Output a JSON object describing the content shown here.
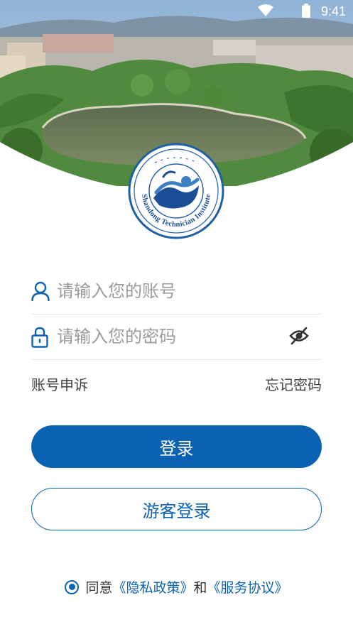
{
  "status_bar": {
    "time": "9:41"
  },
  "logo": {
    "caption": "Shandong Technician Institute",
    "seal_chars": "山东技师学院"
  },
  "form": {
    "account_placeholder": "请输入您的账号",
    "password_placeholder": "请输入您的密码"
  },
  "links": {
    "account_appeal": "账号申诉",
    "forgot_password": "忘记密码"
  },
  "buttons": {
    "login": "登录",
    "guest_login": "游客登录"
  },
  "agreement": {
    "agree_text": "同意",
    "privacy_policy": "《隐私政策》",
    "and_text": "和",
    "service_agreement": "《服务协议》"
  },
  "colors": {
    "primary": "#0b62b3",
    "placeholder": "#9b9b9b",
    "link_text": "#444444"
  },
  "icons": {
    "account": "person-icon",
    "password": "lock-icon",
    "password_toggle": "eye-off-icon",
    "agree": "radio-checked-icon"
  }
}
